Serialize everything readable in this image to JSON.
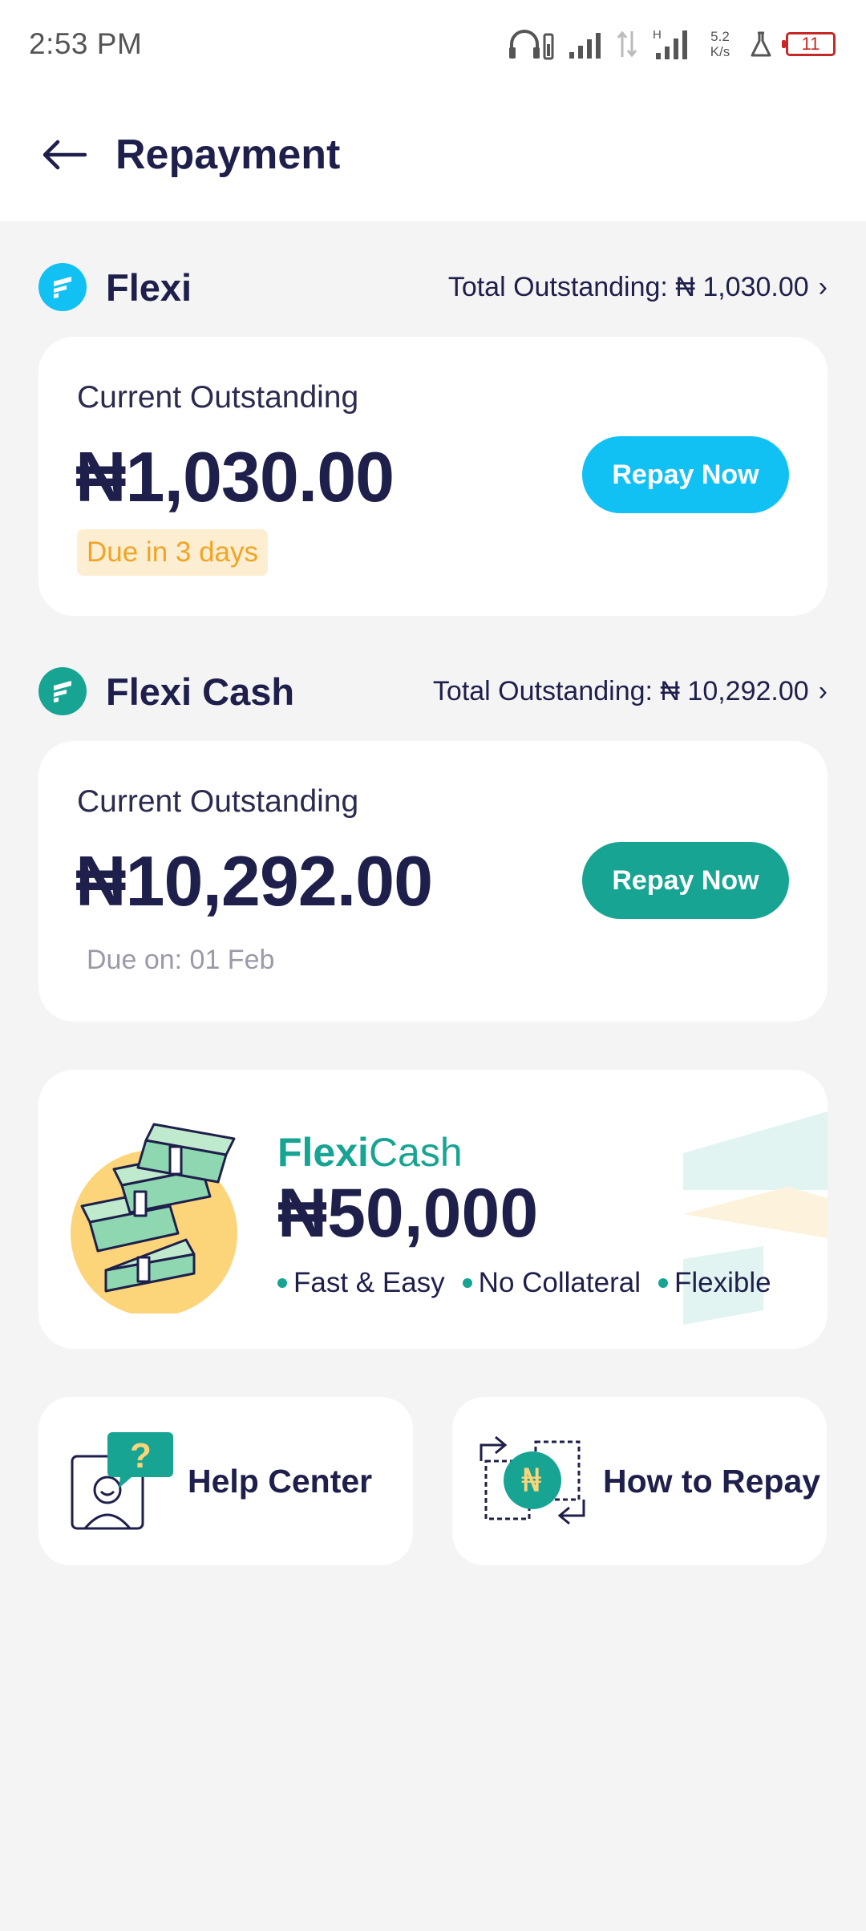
{
  "status_bar": {
    "time": "2:53 PM",
    "speed_value": "5.2",
    "speed_unit": "K/s",
    "battery": "11",
    "network_type": "H"
  },
  "header": {
    "title": "Repayment"
  },
  "loans": [
    {
      "name": "Flexi",
      "total_outstanding": "Total Outstanding: ₦ 1,030.00",
      "current_label": "Current Outstanding",
      "amount": "₦1,030.00",
      "repay_label": "Repay Now",
      "due": "Due in 3 days",
      "accent": "#12c1f4"
    },
    {
      "name": "Flexi Cash",
      "total_outstanding": "Total Outstanding: ₦ 10,292.00",
      "current_label": "Current Outstanding",
      "amount": "₦10,292.00",
      "repay_label": "Repay Now",
      "due": "Due on: 01 Feb",
      "accent": "#17a493"
    }
  ],
  "promo": {
    "brand_bold": "Flexi",
    "brand_light": "Cash",
    "amount": "₦50,000",
    "features": [
      "Fast & Easy",
      "No Collateral",
      "Flexible"
    ]
  },
  "tiles": {
    "help_center": "Help Center",
    "help_badge": "?",
    "how_to_repay": "How to Repay",
    "naira_glyph": "₦"
  },
  "colors": {
    "background": "#f4f4f4",
    "text_primary": "#1e1f4b",
    "flexi_blue": "#12c1f4",
    "flexi_cash_green": "#17a493",
    "due_warning": "#f0a526"
  }
}
